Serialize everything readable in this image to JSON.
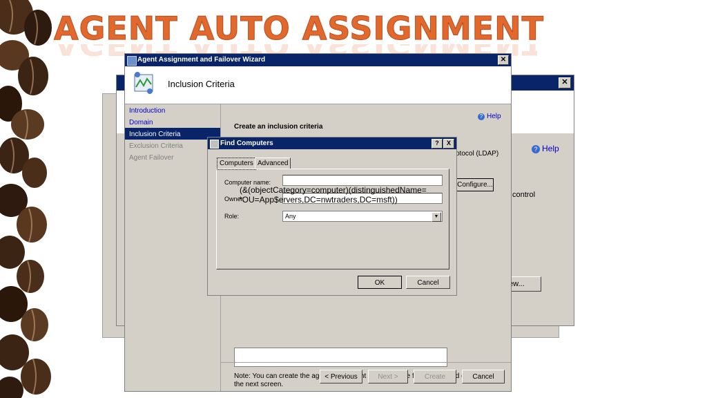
{
  "slide": {
    "title": "AGENT AUTO ASSIGNMENT"
  },
  "background_window": {
    "help": "Help",
    "control_text": "control",
    "new_button": "ew..."
  },
  "wizard": {
    "title": "Agent Assignment and Failover Wizard",
    "header": "Inclusion Criteria",
    "nav": [
      {
        "label": "Introduction",
        "state": "link"
      },
      {
        "label": "Domain",
        "state": "link"
      },
      {
        "label": "Inclusion Criteria",
        "state": "selected"
      },
      {
        "label": "Exclusion Criteria",
        "state": "disabled"
      },
      {
        "label": "Agent Failover",
        "state": "disabled"
      }
    ],
    "help": "Help",
    "content_title": "Create an inclusion criteria",
    "ldap_text": "otocol (LDAP)",
    "configure_button": "Configure...",
    "note": "Note: You can create the agent assignment exclusion rule for the selected domain, on the next screen.",
    "buttons": {
      "previous": "< Previous",
      "next": "Next >",
      "create": "Create",
      "cancel": "Cancel"
    }
  },
  "find_dialog": {
    "title": "Find Computers",
    "help_btn": "?",
    "close_btn": "X",
    "tabs": [
      "Computers",
      "Advanced"
    ],
    "computer_name_label": "Computer name:",
    "owner_label": "Owner:",
    "role_label": "Role:",
    "role_value": "Any",
    "ok": "OK",
    "cancel": "Cancel"
  },
  "ldap_overlay": {
    "line1": "(&(objectCategory=computer)(distinguishedName=",
    "line2": "*OU=App$ervers,DC=nwtraders,DC=msft))"
  },
  "colors": {
    "title": "#e2692d",
    "titlebar": "#0a246a",
    "dialog": "#d4d0c8"
  }
}
